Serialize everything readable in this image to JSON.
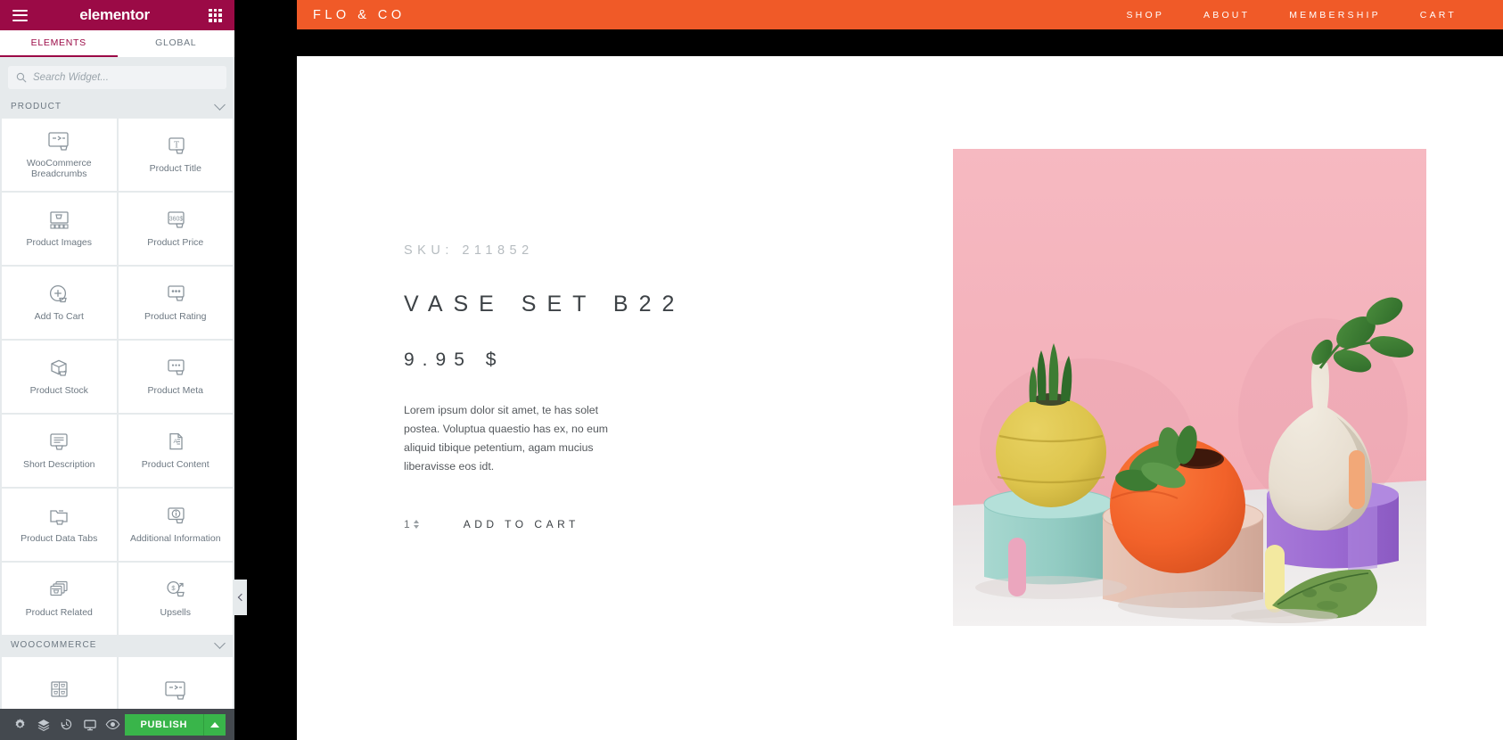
{
  "editor": {
    "brand": "elementor",
    "menu_icon": "hamburger-icon",
    "apps_icon": "grid-apps-icon",
    "tabs": [
      {
        "label": "ELEMENTS",
        "active": true
      },
      {
        "label": "GLOBAL",
        "active": false
      }
    ],
    "search": {
      "placeholder": "Search Widget...",
      "value": "",
      "icon": "search-icon"
    },
    "sections": [
      {
        "id": "product",
        "label": "PRODUCT",
        "collapsed": false,
        "widgets": [
          {
            "label": "WooCommerce Breadcrumbs",
            "icon": "breadcrumbs-cart-icon"
          },
          {
            "label": "Product Title",
            "icon": "product-title-icon"
          },
          {
            "label": "Product Images",
            "icon": "product-images-icon"
          },
          {
            "label": "Product Price",
            "icon": "product-price-icon"
          },
          {
            "label": "Add To Cart",
            "icon": "add-to-cart-icon"
          },
          {
            "label": "Product Rating",
            "icon": "product-rating-icon"
          },
          {
            "label": "Product Stock",
            "icon": "product-stock-icon"
          },
          {
            "label": "Product Meta",
            "icon": "product-meta-icon"
          },
          {
            "label": "Short Description",
            "icon": "short-description-icon"
          },
          {
            "label": "Product Content",
            "icon": "product-content-icon"
          },
          {
            "label": "Product Data Tabs",
            "icon": "product-data-tabs-icon"
          },
          {
            "label": "Additional Information",
            "icon": "additional-information-icon"
          },
          {
            "label": "Product Related",
            "icon": "product-related-icon"
          },
          {
            "label": "Upsells",
            "icon": "upsells-icon"
          }
        ]
      },
      {
        "id": "woocommerce",
        "label": "WOOCOMMERCE",
        "collapsed": false,
        "widgets": [
          {
            "label": "",
            "icon": "products-grid-icon"
          },
          {
            "label": "",
            "icon": "breadcrumbs-cart-icon"
          }
        ]
      }
    ],
    "footer": {
      "buttons": [
        {
          "name": "settings",
          "icon": "gear-icon"
        },
        {
          "name": "navigator",
          "icon": "layers-icon"
        },
        {
          "name": "history",
          "icon": "history-icon"
        },
        {
          "name": "responsive-mode",
          "icon": "monitor-icon"
        },
        {
          "name": "preview-changes",
          "icon": "eye-icon"
        }
      ],
      "publish_label": "PUBLISH",
      "publish_color": "#39b54a",
      "publish_options_icon": "caret-up-icon"
    },
    "collapse_handle_icon": "chevron-left-icon",
    "accent_color": "#9b0a46",
    "panel_bg": "#e6eaec",
    "footer_bg": "#44494f"
  },
  "site": {
    "header": {
      "logo": "FLO & CO",
      "bg_color": "#f05a28",
      "nav": [
        {
          "label": "SHOP"
        },
        {
          "label": "ABOUT"
        },
        {
          "label": "MEMBERSHIP"
        },
        {
          "label": "CART"
        }
      ]
    },
    "product": {
      "sku": "SKU: 211852",
      "title": "VASE SET B22",
      "price": "9.95 $",
      "description": "Lorem ipsum dolor sit amet, te has solet postea. Voluptua quaestio has ex, no eum aliquid tibique petentium, agam mucius liberavisse eos idt.",
      "quantity": "1",
      "add_to_cart_label": "ADD TO CART",
      "image_alt": "Three ceramic vases with plants on pastel pedestals against a pink background",
      "image_colors": {
        "backdrop_pink": "#f4b3bc",
        "floor": "#eceaea",
        "yellow_vase": "#dec44e",
        "orange_vase": "#f2622a",
        "cream_vase": "#ece4d6",
        "teal_pedestal": "#9fd3cb",
        "blush_pedestal": "#e3beaf",
        "purple_pedestal": "#9d6fd0",
        "pink_stick": "#eba6be",
        "yellow_stick": "#f3e9a0",
        "peach_stick": "#f2a878",
        "leaf_green": "#3c7a33"
      }
    }
  }
}
